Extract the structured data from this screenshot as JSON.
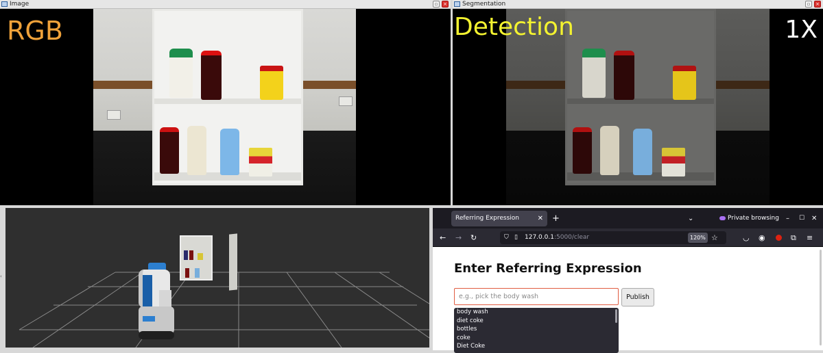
{
  "image_window": {
    "title": "Image",
    "overlay_label": "RGB",
    "label_color": "#f0a23a"
  },
  "segmentation_window": {
    "title": "Segmentation",
    "overlay_label": "Detection",
    "zoom_label": "1X",
    "label_color": "#f3f230"
  },
  "browser": {
    "tab_title": "Referring Expression",
    "new_tab_symbol": "+",
    "private_label": "Private browsing",
    "url_host": "127.0.0.1",
    "url_path": ":5000/clear",
    "zoom": "120%",
    "page_heading": "Enter Referring Expression",
    "input_placeholder": "e.g., pick the body wash",
    "publish_label": "Publish",
    "suggestions": [
      "body wash",
      "diet coke",
      "bottles",
      "coke",
      "Diet Coke"
    ]
  },
  "icons": [
    "window-icon",
    "maximize-icon",
    "close-icon",
    "back-icon",
    "forward-icon",
    "reload-icon",
    "shield-icon",
    "page-icon",
    "bookmark-star-icon",
    "pocket-icon",
    "account-icon",
    "extensions-icon",
    "menu-icon",
    "private-mask-icon"
  ]
}
